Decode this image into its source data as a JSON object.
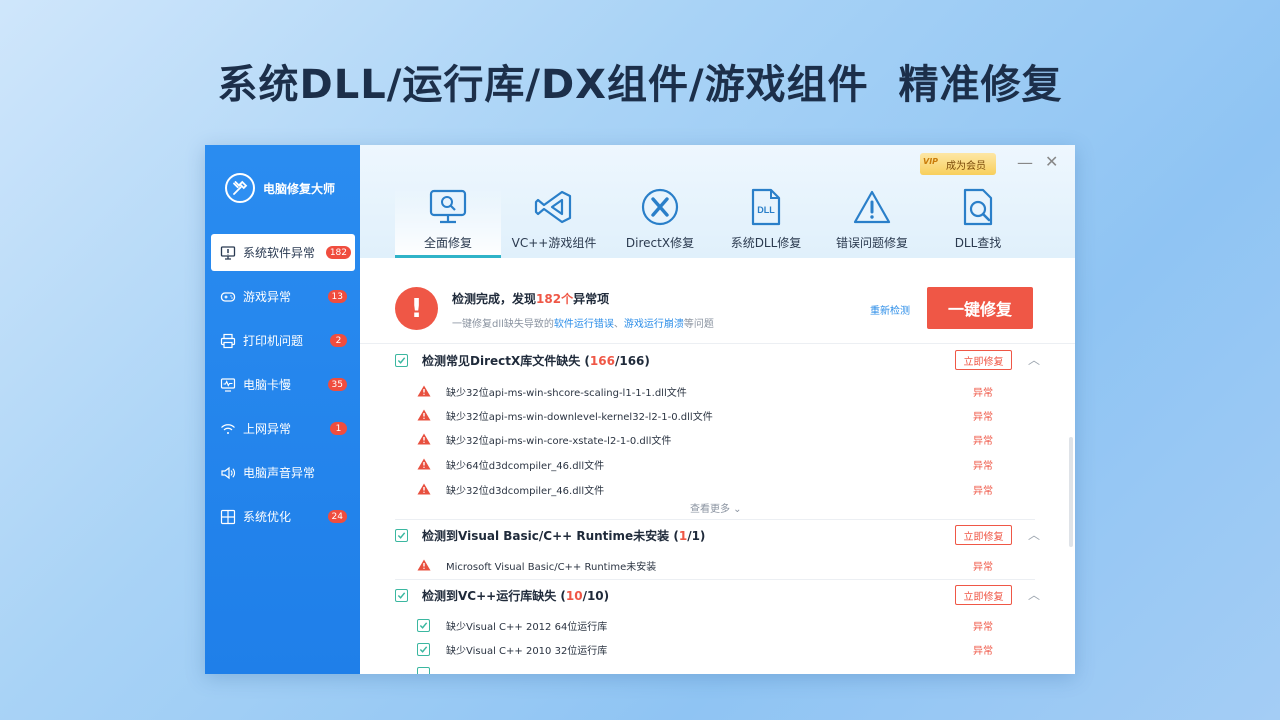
{
  "headline": "系统DLL/运行库/DX组件/游戏组件  精准修复",
  "app": {
    "name": "电脑修复大师"
  },
  "sidebar": {
    "items": [
      {
        "label": "系统软件异常",
        "badge": "182",
        "icon": "monitor-alert-icon",
        "active": true
      },
      {
        "label": "游戏异常",
        "badge": "13",
        "icon": "gamepad-icon"
      },
      {
        "label": "打印机问题",
        "badge": "2",
        "icon": "printer-icon"
      },
      {
        "label": "电脑卡慢",
        "badge": "35",
        "icon": "pulse-monitor-icon"
      },
      {
        "label": "上网异常",
        "badge": "1",
        "icon": "wifi-icon"
      },
      {
        "label": "电脑声音异常",
        "badge": "",
        "icon": "speaker-icon"
      },
      {
        "label": "系统优化",
        "badge": "24",
        "icon": "windows-icon"
      }
    ]
  },
  "topbar": {
    "vip_tag": "VIP",
    "vip_label": "成为会员",
    "minimize": "—",
    "close": "✕",
    "tabs": [
      {
        "label": "全面修复",
        "icon": "monitor-search-icon",
        "active": true
      },
      {
        "label": "VC++游戏组件",
        "icon": "visual-studio-icon"
      },
      {
        "label": "DirectX修复",
        "icon": "directx-icon"
      },
      {
        "label": "系统DLL修复",
        "icon": "dll-file-icon"
      },
      {
        "label": "错误问题修复",
        "icon": "warning-triangle-icon"
      },
      {
        "label": "DLL查找",
        "icon": "file-search-icon"
      }
    ]
  },
  "summary": {
    "title_prefix": "检测完成，发现",
    "count": "182个",
    "title_suffix": "异常项",
    "sub_prefix": "一键修复dll缺失导致的",
    "sub_link1": "软件运行错误",
    "sub_sep": "、",
    "sub_link2": "游戏运行崩溃",
    "sub_suffix": "等问题",
    "rescan": "重新检测",
    "fix_all": "一键修复"
  },
  "sections": [
    {
      "title": "检测常见DirectX库文件缺失 (",
      "found": "166",
      "total": "/166)",
      "fix_label": "立即修复",
      "rows": [
        {
          "text": "缺少32位api-ms-win-shcore-scaling-l1-1-1.dll文件",
          "status": "异常"
        },
        {
          "text": "缺少32位api-ms-win-downlevel-kernel32-l2-1-0.dll文件",
          "status": "异常"
        },
        {
          "text": "缺少32位api-ms-win-core-xstate-l2-1-0.dll文件",
          "status": "异常"
        },
        {
          "text": "缺少64位d3dcompiler_46.dll文件",
          "status": "异常"
        },
        {
          "text": "缺少32位d3dcompiler_46.dll文件",
          "status": "异常"
        }
      ],
      "more": "查看更多 ⌄"
    },
    {
      "title": "检测到Visual Basic/C++ Runtime未安装 (",
      "found": "1",
      "total": "/1)",
      "fix_label": "立即修复",
      "rows": [
        {
          "text": "Microsoft Visual Basic/C++ Runtime未安装",
          "status": "异常"
        }
      ]
    },
    {
      "title": "检测到VC++运行库缺失 (",
      "found": "10",
      "total": "/10)",
      "fix_label": "立即修复",
      "rows": [
        {
          "text": "缺少Visual C++ 2012 64位运行库",
          "status": "异常"
        },
        {
          "text": "缺少Visual C++ 2010 32位运行库",
          "status": "异常"
        }
      ]
    }
  ],
  "colors": {
    "accent": "#2a8cf0",
    "danger": "#ef5746",
    "check": "#3bb7a0"
  }
}
